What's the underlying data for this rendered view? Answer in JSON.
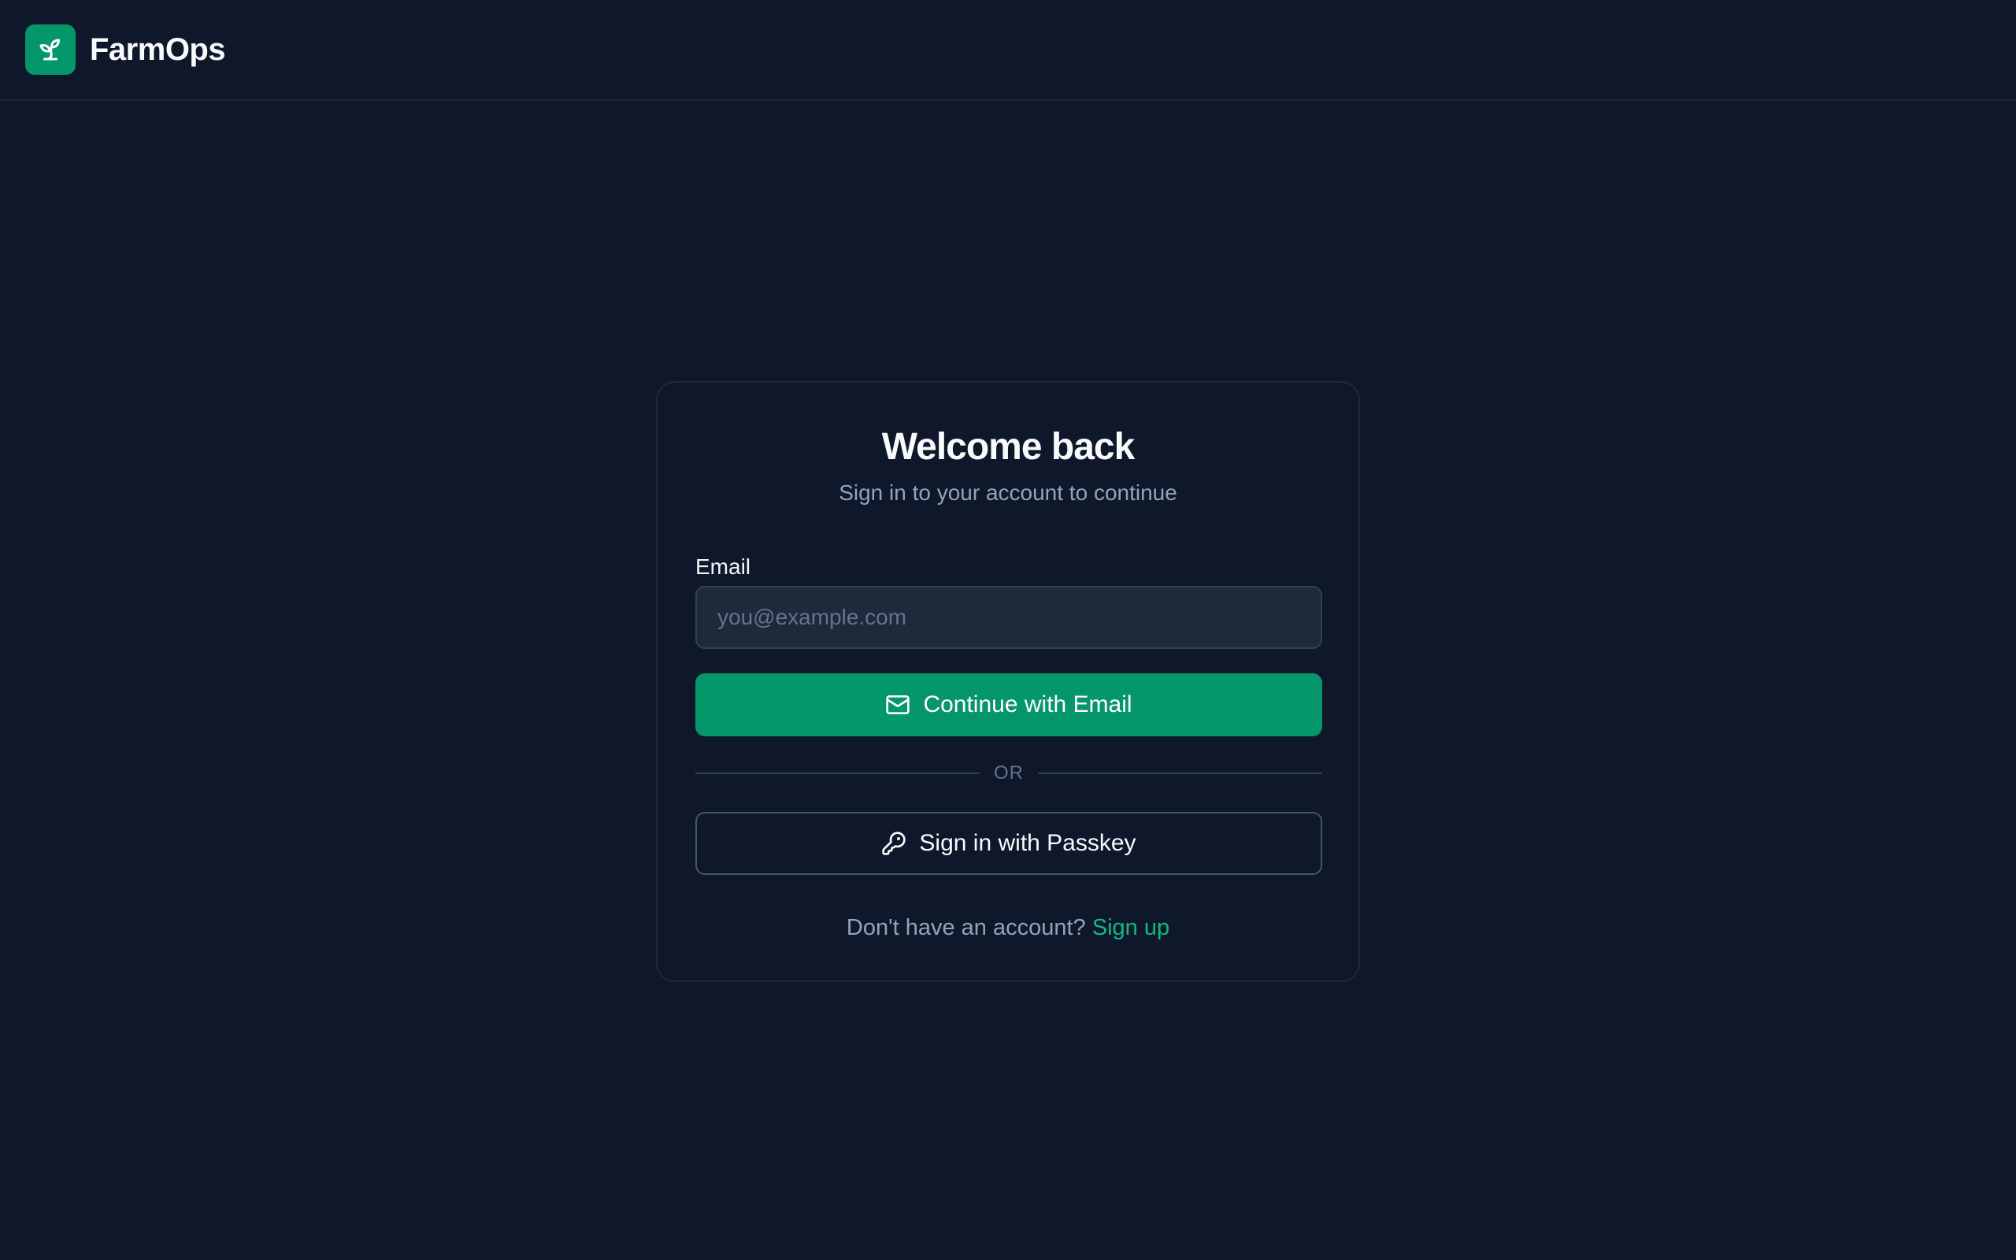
{
  "app": {
    "brand_name": "FarmOps",
    "logo_icon": "sprout-icon",
    "accent_color": "#059669",
    "background_color": "#0f172a"
  },
  "login": {
    "title": "Welcome back",
    "subtitle": "Sign in to your account to continue",
    "email_label": "Email",
    "email_value": "",
    "email_placeholder": "you@example.com",
    "continue_email_label": "Continue with Email",
    "continue_email_icon": "mail-icon",
    "divider_text": "OR",
    "passkey_label": "Sign in with Passkey",
    "passkey_icon": "key-icon",
    "no_account_text": "Don't have an account?",
    "signup_link": "Sign up"
  }
}
